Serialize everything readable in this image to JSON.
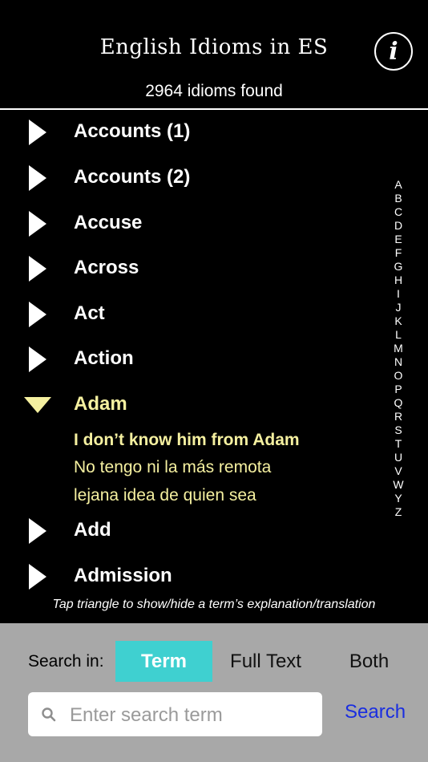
{
  "header": {
    "title": "English Idioms in ES",
    "info_icon": "info-icon",
    "info_glyph": "i"
  },
  "count_text": "2964 idioms found",
  "list": [
    {
      "term": "Accounts (1)",
      "expanded": false
    },
    {
      "term": "Accounts (2)",
      "expanded": false
    },
    {
      "term": "Accuse",
      "expanded": false
    },
    {
      "term": "Across",
      "expanded": false
    },
    {
      "term": "Act",
      "expanded": false
    },
    {
      "term": "Action",
      "expanded": false
    },
    {
      "term": "Adam",
      "expanded": true,
      "idiom": "I don’t know him from Adam",
      "translation_line1": "No tengo ni la más remota",
      "translation_line2": "lejana idea de quien sea"
    },
    {
      "term": "Add",
      "expanded": false
    },
    {
      "term": "Admission",
      "expanded": false
    }
  ],
  "alphabet": [
    "A",
    "B",
    "C",
    "D",
    "E",
    "F",
    "G",
    "H",
    "I",
    "J",
    "K",
    "L",
    "M",
    "N",
    "O",
    "P",
    "Q",
    "R",
    "S",
    "T",
    "U",
    "V",
    "W",
    "Y",
    "Z"
  ],
  "hint": "Tap triangle to show/hide a term’s explanation/translation",
  "search": {
    "label": "Search in:",
    "modes": [
      "Term",
      "Full Text",
      "Both"
    ],
    "active_mode": "Term",
    "placeholder": "Enter search term",
    "value": "",
    "button": "Search"
  },
  "colors": {
    "accent": "#3fd0d0",
    "expanded_text": "#f5f0a0",
    "link": "#1a2ee0",
    "panel": "#a8a8a8"
  }
}
